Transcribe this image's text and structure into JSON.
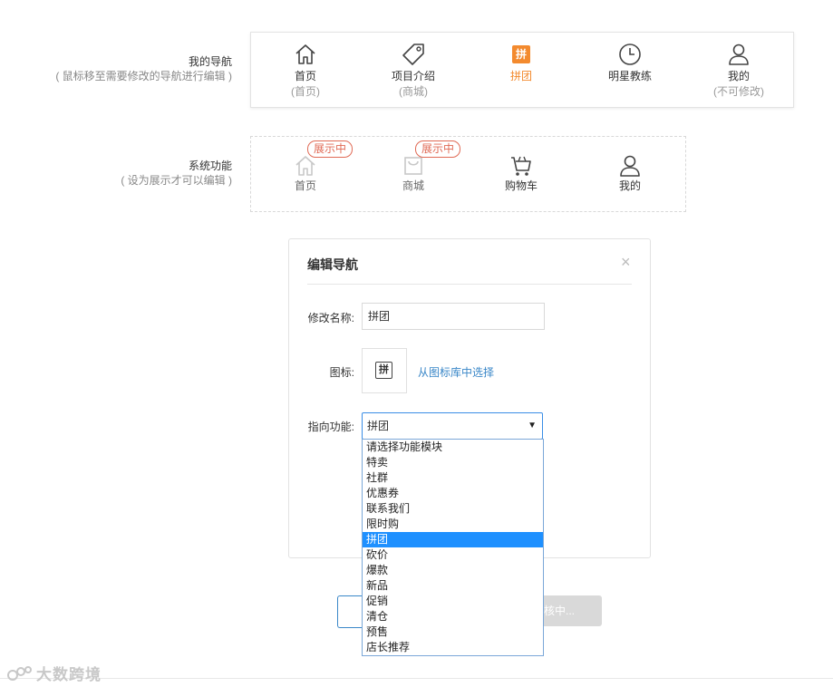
{
  "my_nav": {
    "label": "我的导航",
    "hint": "( 鼠标移至需要修改的导航进行编辑 )",
    "items": [
      {
        "label": "首页",
        "sub": "(首页)",
        "icon": "home-icon"
      },
      {
        "label": "项目介绍",
        "sub": "(商城)",
        "icon": "tag-icon"
      },
      {
        "label": "拼团",
        "sub": "",
        "icon": "pin-icon",
        "icon_text": "拼"
      },
      {
        "label": "明星教练",
        "sub": "",
        "icon": "clock-icon"
      },
      {
        "label": "我的",
        "sub": "(不可修改)",
        "icon": "user-icon"
      }
    ]
  },
  "system": {
    "label": "系统功能",
    "hint": "( 设为展示才可以编辑 )",
    "items": [
      {
        "label": "首页",
        "badge": "展示中",
        "icon": "home-icon"
      },
      {
        "label": "商城",
        "badge": "展示中",
        "icon": "bag-icon"
      },
      {
        "label": "购物车",
        "badge": "",
        "icon": "cart-icon"
      },
      {
        "label": "我的",
        "badge": "",
        "icon": "user-icon"
      }
    ]
  },
  "modal": {
    "title": "编辑导航",
    "close": "×",
    "name_label": "修改名称:",
    "name_value": "拼团",
    "icon_label": "图标:",
    "icon_text": "拼",
    "icon_link": "从图标库中选择",
    "func_label": "指向功能:",
    "func_value": "拼团",
    "arrow": "▼"
  },
  "dropdown": {
    "options": [
      "请选择功能模块",
      "特卖",
      "社群",
      "优惠券",
      "联系我们",
      "限时购",
      "拼团",
      "砍价",
      "爆款",
      "新品",
      "促销",
      "清仓",
      "预售",
      "店长推荐"
    ],
    "selected_index": 6
  },
  "buttons": {
    "submit_partial": "核中..."
  },
  "watermark": {
    "text": "大数跨境"
  },
  "colors": {
    "accent": "#f38a2e",
    "badge": "#e06a55",
    "link": "#3a87c8",
    "selected": "#1e90ff"
  }
}
